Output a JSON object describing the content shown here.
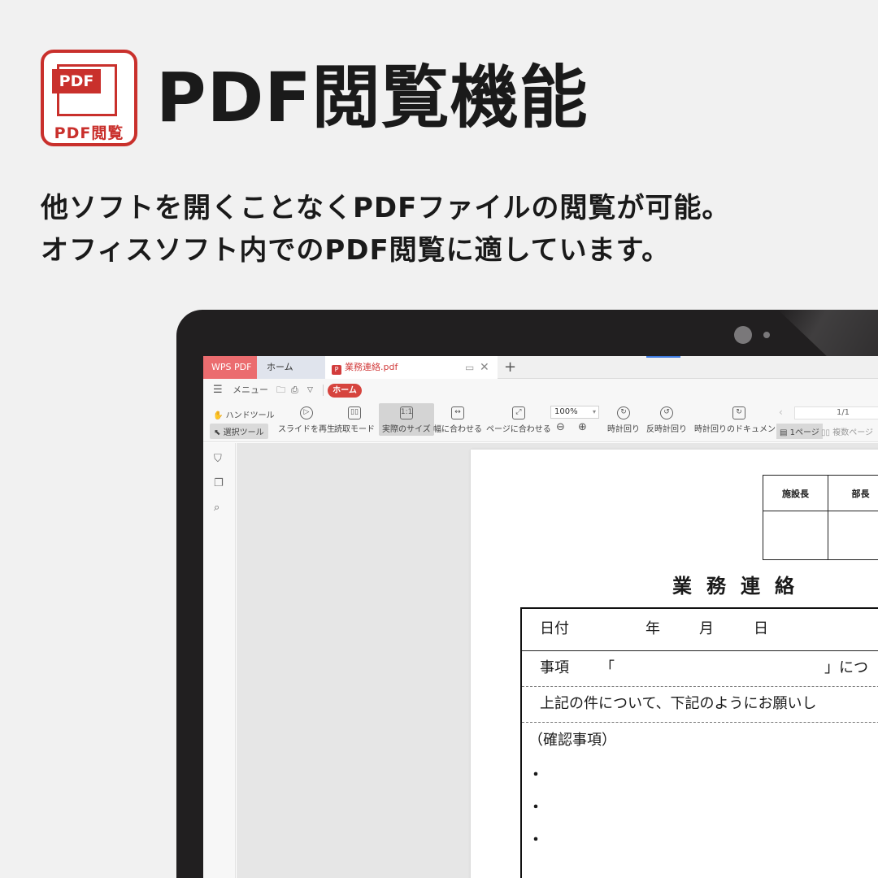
{
  "header": {
    "logo_badge": "PDF",
    "logo_caption": "PDF閲覧",
    "title": "PDF閲覧機能",
    "lead_line1": "他ソフトを開くことなくPDFファイルの閲覧が可能。",
    "lead_line2": "オフィスソフト内でのPDF閲覧に適しています。"
  },
  "app": {
    "tabs": {
      "app_name": "WPS PDF",
      "home": "ホーム",
      "document": "業務連絡.pdf",
      "add": "+"
    },
    "menu": {
      "hamburger": "☰",
      "menu_label": "メニュー",
      "home_pill": "ホーム"
    },
    "toolbar": {
      "hand_tool": "ハンドツール",
      "select_tool": "選択ツール",
      "slideshow": "スライドを再生",
      "read_mode": "読取モード",
      "actual_size": "実際のサイズ",
      "fit_width": "幅に合わせる",
      "fit_page": "ページに合わせる",
      "zoom_value": "100%",
      "rotate_cw": "時計回り",
      "rotate_ccw": "反時計回り",
      "rotate_doc": "時計回りのドキュメント",
      "page_indicator": "1/1",
      "single_page": "1ページ",
      "multi_page": "複数ページ"
    }
  },
  "pdf": {
    "approval_headers": [
      "施設長",
      "部長"
    ],
    "title": "業務連絡",
    "date_label": "日付",
    "year": "年",
    "month": "月",
    "day": "日",
    "subject_label": "事項",
    "quote_open": "「",
    "quote_close_suffix": "」につ",
    "request_line": "上記の件について、下記のようにお願いし",
    "confirm_heading": "（確認事項）",
    "bullet": "・"
  }
}
